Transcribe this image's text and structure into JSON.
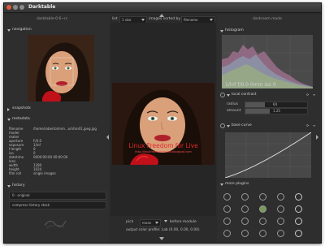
{
  "window": {
    "title": "Darktable"
  },
  "left": {
    "version": "darktable-0.6~rc",
    "navigation_label": "navigation",
    "snapshots_label": "snapshots",
    "metadata_label": "metadata",
    "metadata": [
      {
        "key": "filename",
        "value": "/home/roberto/imm...o/nfon01.jpeg.jpg"
      },
      {
        "key": "model",
        "value": ""
      },
      {
        "key": "maker",
        "value": ""
      },
      {
        "key": "aperture",
        "value": "F/0.0"
      },
      {
        "key": "exposure",
        "value": "1/inf"
      },
      {
        "key": "f-length",
        "value": "0"
      },
      {
        "key": "iso",
        "value": "0"
      },
      {
        "key": "datetime",
        "value": "0000:00:00 00:00:00"
      },
      {
        "key": "lens",
        "value": ""
      },
      {
        "key": "width",
        "value": "1280"
      },
      {
        "key": "height",
        "value": "1024"
      },
      {
        "key": "film roll",
        "value": "single images"
      }
    ],
    "history_label": "history",
    "history_items": [
      "0 - original"
    ],
    "compress_label": "compress history stack"
  },
  "topbar": {
    "list_label": "list",
    "rating": "1 star",
    "sorted_label": "images sorted by",
    "sort_key": "filename",
    "mode": "darkroom mode"
  },
  "center": {
    "watermark_line1": "Linux Freedom for Live",
    "watermark_line2": "http://linuxfreedomforlive.blogspot.com",
    "pick_label": "pick",
    "mean_label": "mean",
    "before_label": "before module",
    "profile_text": "output color profile: Lab (0.00, 0.00, 0.00)"
  },
  "right": {
    "histogram_label": "histogram",
    "histogram_info": "1/inf f/0.0 0mm iso 0",
    "local_contrast_label": "local contrast",
    "radius_label": "radius",
    "radius_value": "64",
    "amount_label": "amount",
    "amount_value": "1.25",
    "base_curve_label": "base curve",
    "more_plugins_label": "more plugins"
  },
  "colors": {
    "bg": "#2e2e2e",
    "accent": "#c8c8c8",
    "face": "#d9a07a",
    "lips": "#b0202a"
  }
}
